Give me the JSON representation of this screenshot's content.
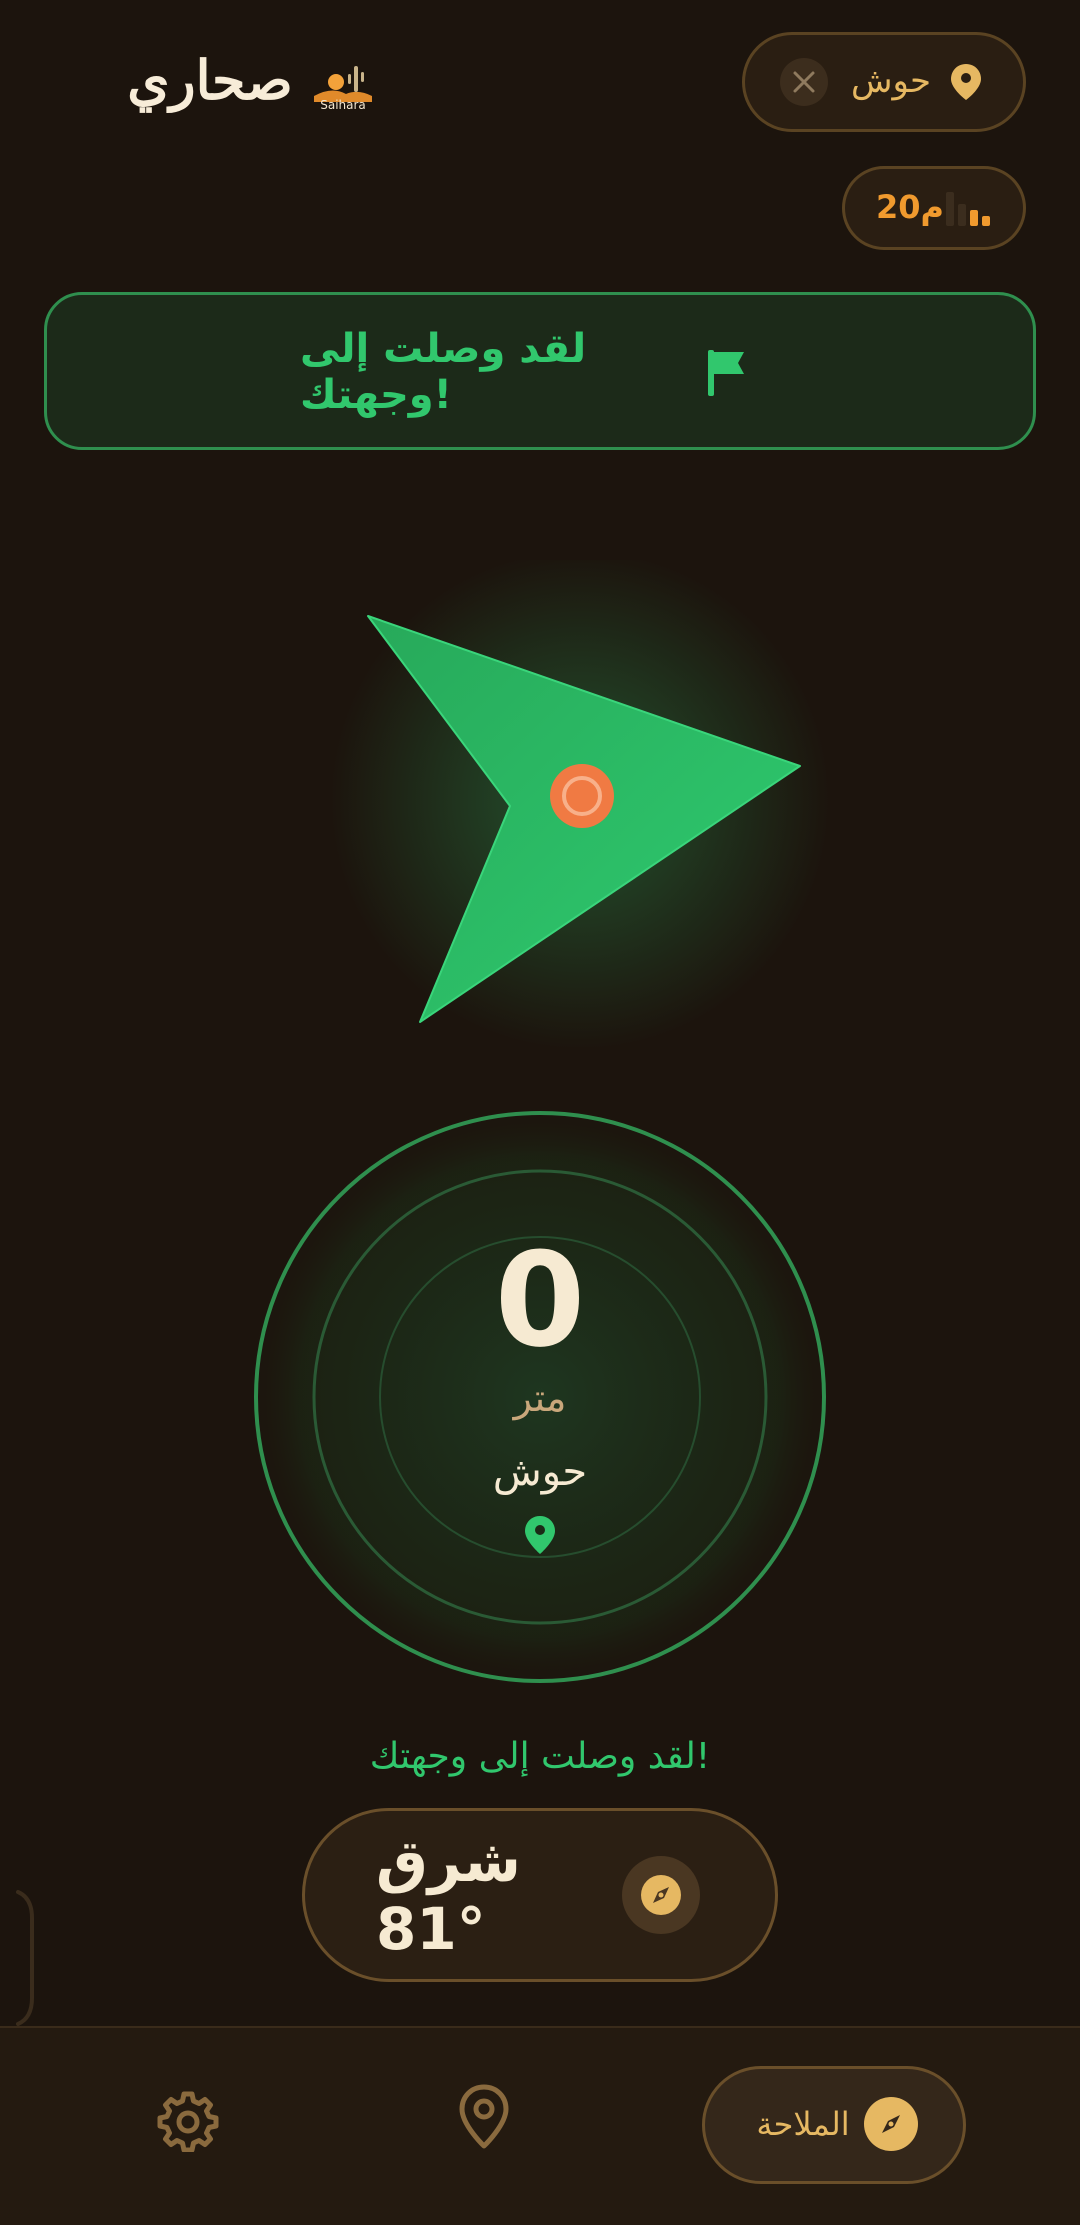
{
  "header": {
    "title": "صحاري",
    "logo_text": "Saihara",
    "destination_label": "حوش",
    "accuracy_value": "20م"
  },
  "banner": {
    "text": "لقد وصلت إلى وجهتك!"
  },
  "distance": {
    "value": "0",
    "unit": "متر",
    "destination_name": "حوش"
  },
  "arrival_message": "لقد وصلت إلى وجهتك!",
  "heading": {
    "text": "شرق 81°"
  },
  "nav": {
    "active_label": "الملاحة"
  },
  "colors": {
    "background": "#1c140d",
    "accent_gold": "#e6b862",
    "success_green": "#31c76d",
    "marker_orange": "#f07a43"
  },
  "icons": [
    "close-icon",
    "map-pin-icon",
    "signal-bars-icon",
    "flag-icon",
    "compass-icon",
    "gear-icon",
    "location-icon"
  ]
}
